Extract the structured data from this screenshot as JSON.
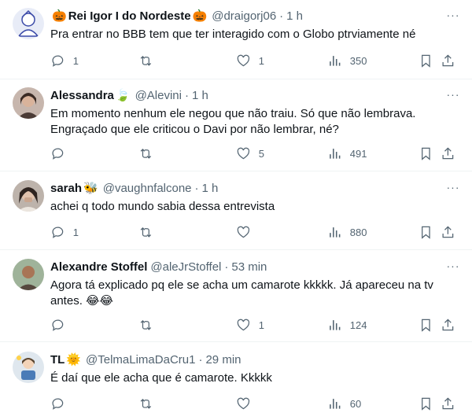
{
  "tweets": [
    {
      "name": "Rei Igor I do Nordeste",
      "name_prefix_emoji": "🎃",
      "name_suffix_emoji": "🎃",
      "handle": "@draigorj06",
      "time": "1 h",
      "text": [
        "Pra entrar no BBB tem que ter interagido com o Globo ptrviamente né"
      ],
      "replies": "1",
      "retweets": "",
      "likes": "1",
      "views": "350",
      "avatar": "anime-character-icon"
    },
    {
      "name": "Alessandra",
      "name_suffix_emoji": "🍃",
      "handle": "@Alevini",
      "time": "1 h",
      "text": [
        "Em momento nenhum ele negou que não traiu. Só que não lembrava.",
        "Engraçado que ele criticou o Davi por não lembrar, né?"
      ],
      "replies": "",
      "retweets": "",
      "likes": "5",
      "views": "491",
      "avatar": "woman-photo"
    },
    {
      "name": "sarah",
      "name_suffix_emoji": "🐝",
      "handle": "@vaughnfalcone",
      "time": "1 h",
      "text": [
        "achei q todo mundo sabia dessa entrevista"
      ],
      "replies": "1",
      "retweets": "",
      "likes": "",
      "views": "880",
      "avatar": "woman-photo"
    },
    {
      "name": "Alexandre Stoffel",
      "handle": "@aleJrStoffel",
      "time": "53 min",
      "text": [
        "Agora tá explicado pq ele se acha um camarote kkkkk. Já apareceu na tv",
        "antes. 😂😂"
      ],
      "replies": "",
      "retweets": "",
      "likes": "1",
      "views": "124",
      "avatar": "man-photo"
    },
    {
      "name": "TL",
      "name_suffix_emoji": "🌞",
      "handle": "@TelmaLimaDaCru1",
      "time": "29 min",
      "text": [
        "É daí que ele acha que é camarote. Kkkkk"
      ],
      "replies": "",
      "retweets": "",
      "likes": "",
      "views": "60",
      "avatar": "cartoon-avatar"
    }
  ],
  "separator": "·",
  "more_label": "···"
}
